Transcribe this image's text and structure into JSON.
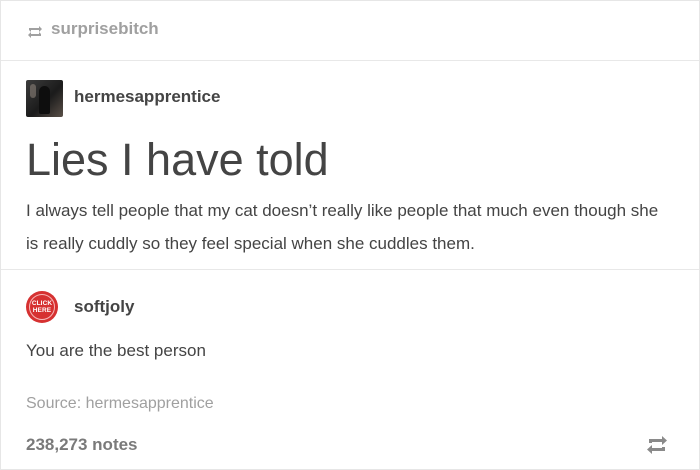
{
  "reblogger": {
    "username": "surprisebitch",
    "icon": "reblog-icon"
  },
  "original": {
    "username": "hermesapprentice",
    "title": "Lies I have told",
    "body": "I always tell people that my cat doesn’t really like people that much even though she is really cuddly so they feel special when she cuddles them."
  },
  "reply": {
    "username": "softjoly",
    "avatar_text_1": "CLICK",
    "avatar_text_2": "HERE",
    "text": "You are the best person"
  },
  "footer": {
    "source": "Source: hermesapprentice",
    "notes": "238,273 notes",
    "reblog_icon": "reblog-icon"
  },
  "colors": {
    "text": "#444444",
    "muted": "#a0a0a0",
    "avatar_red": "#d63131"
  }
}
